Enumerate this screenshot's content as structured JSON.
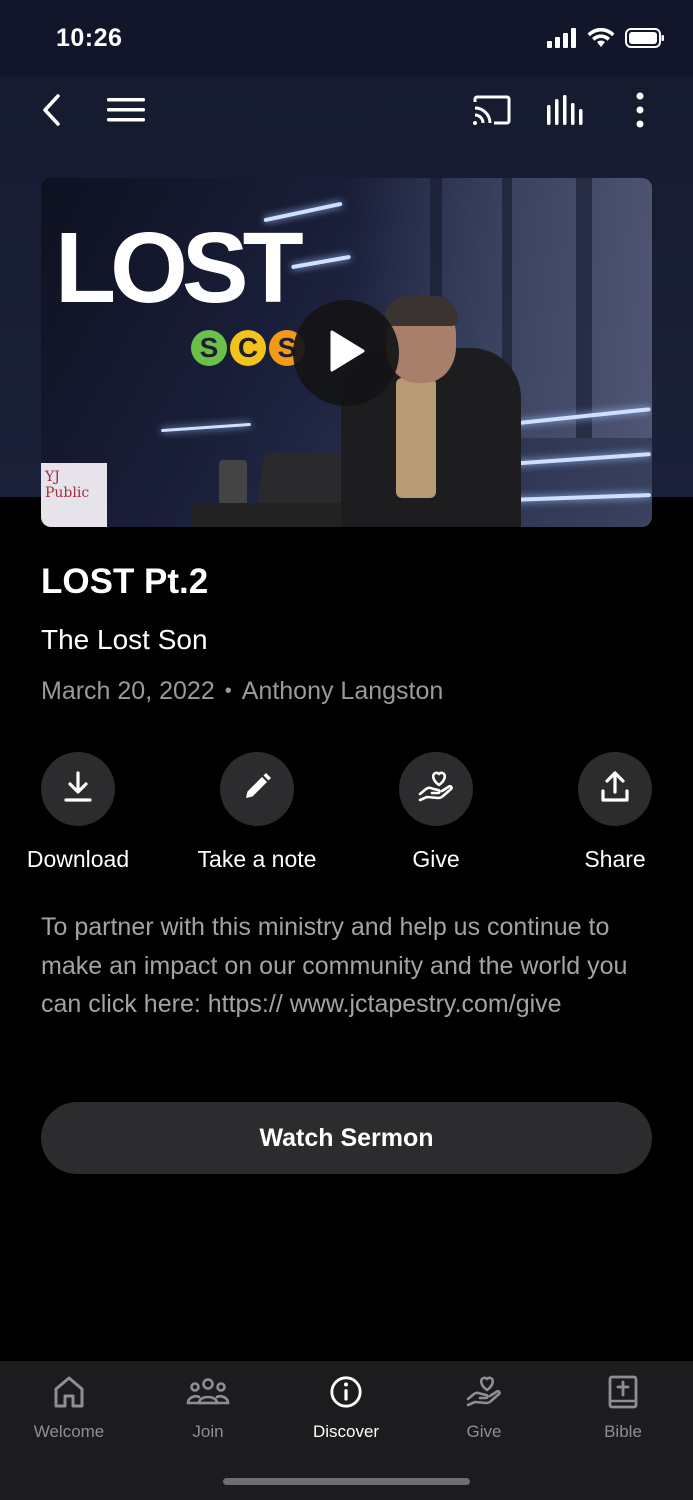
{
  "status_bar": {
    "time": "10:26"
  },
  "nav": {
    "icons": [
      "back-icon",
      "menu-icon",
      "cast-icon",
      "audio-bars-icon",
      "more-icon"
    ]
  },
  "hero": {
    "title_text": "LOST",
    "badge_letters": [
      "S",
      "C",
      "S"
    ],
    "badge_colors": [
      "#6cc04a",
      "#f3c21b",
      "#f39a1b"
    ],
    "whiteboard_text": "YJ Public"
  },
  "sermon": {
    "title": "LOST Pt.2",
    "subtitle": "The Lost Son",
    "date": "March 20, 2022",
    "separator": "•",
    "speaker": "Anthony Langston"
  },
  "actions": [
    {
      "label": "Download",
      "icon": "download-icon"
    },
    {
      "label": "Take a note",
      "icon": "pencil-icon"
    },
    {
      "label": "Give",
      "icon": "give-heart-hand-icon"
    },
    {
      "label": "Share",
      "icon": "share-icon"
    }
  ],
  "description": "To partner with this ministry and help us continue to make an impact on our community and the world you can click here: https:// www.jctapestry.com/give",
  "watch_button": "Watch Sermon",
  "tabs": [
    {
      "label": "Welcome",
      "icon": "home-icon",
      "active": false
    },
    {
      "label": "Join",
      "icon": "people-icon",
      "active": false
    },
    {
      "label": "Discover",
      "icon": "info-icon",
      "active": true
    },
    {
      "label": "Give",
      "icon": "give-heart-hand-icon",
      "active": false
    },
    {
      "label": "Bible",
      "icon": "bible-icon",
      "active": false
    }
  ],
  "colors": {
    "background": "#000000",
    "surface": "#2c2c2e",
    "tab_bar": "#1c1c1e",
    "muted_text": "#9a9a9e"
  }
}
